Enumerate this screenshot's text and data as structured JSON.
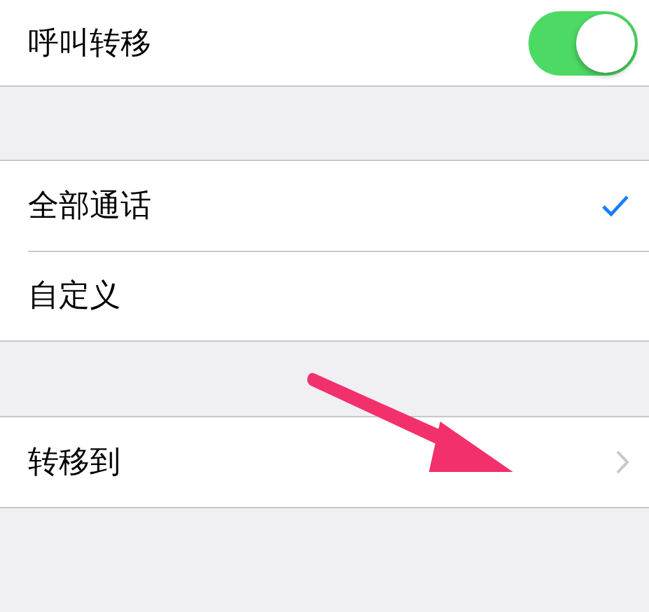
{
  "switch_row": {
    "label": "呼叫转移",
    "on": true
  },
  "options": [
    {
      "label": "全部通话",
      "selected": true
    },
    {
      "label": "自定义",
      "selected": false
    }
  ],
  "forward_row": {
    "label": "转移到"
  }
}
